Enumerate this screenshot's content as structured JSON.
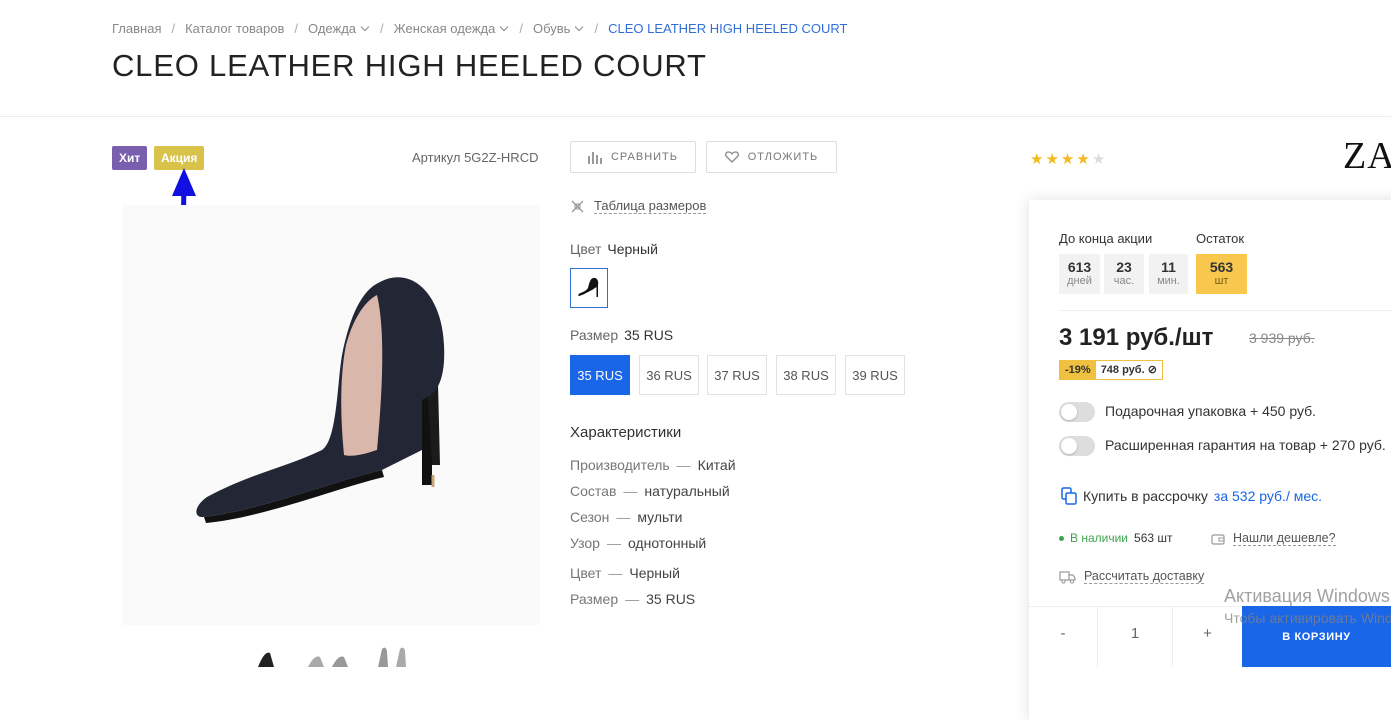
{
  "breadcrumb": {
    "items": [
      "Главная",
      "Каталог товаров",
      "Одежда",
      "Женская одежда",
      "Обувь"
    ],
    "current": "CLEO LEATHER HIGH HEELED COURT"
  },
  "product": {
    "title": "CLEO LEATHER HIGH HEELED COURT",
    "badges": {
      "hit": "Хит",
      "sale": "Акция"
    },
    "article": "Артикул 5G2Z-HRCD",
    "rating": 4
  },
  "actions": {
    "compare": "СРАВНИТЬ",
    "defer": "ОТЛОЖИТЬ",
    "size_table": "Таблица размеров"
  },
  "brand": "ZAR",
  "color": {
    "label": "Цвет",
    "value": "Черный"
  },
  "size": {
    "label": "Размер",
    "value": "35 RUS",
    "options": [
      "35 RUS",
      "36 RUS",
      "37 RUS",
      "38 RUS",
      "39 RUS"
    ]
  },
  "characteristics": {
    "title": "Характеристики",
    "rows": [
      {
        "k": "Производитель",
        "v": "Китай"
      },
      {
        "k": "Состав",
        "v": "натуральный"
      },
      {
        "k": "Сезон",
        "v": "мульти"
      },
      {
        "k": "Узор",
        "v": "однотонный"
      },
      {
        "k": "Цвет",
        "v": "Черный"
      },
      {
        "k": "Размер",
        "v": "35 RUS"
      }
    ]
  },
  "buy": {
    "timer_label": "До конца акции",
    "stock_label": "Остаток",
    "timer": [
      {
        "n": "613",
        "u": "дней"
      },
      {
        "n": "23",
        "u": "час."
      },
      {
        "n": "11",
        "u": "мин."
      }
    ],
    "stock": {
      "n": "563",
      "u": "шт"
    },
    "price": "3 191 руб./шт",
    "old_price": "3 939 руб.",
    "discount_pct": "-19%",
    "discount_amount": "748 руб.",
    "options": [
      "Подарочная упаковка + 450 руб.",
      "Расширенная гарантия на товар + 270 руб."
    ],
    "installment_text": "Купить в рассрочку",
    "installment_link": "за 532 руб./ мес.",
    "availability": "В наличии",
    "availability_count": "563 шт",
    "cheaper": "Нашли дешевле?",
    "delivery": "Рассчитать доставку",
    "qty": {
      "minus": "-",
      "value": "1",
      "plus": "+"
    },
    "cart": "В КОРЗИНУ"
  },
  "watermark": {
    "line1": "Активация Windows",
    "line2": "Чтобы активировать Windows"
  },
  "colors": {
    "accent": "#1a66e8",
    "hit": "#7a5fae",
    "sale": "#d9c24a",
    "stock": "#f8c84e",
    "annotation_arrow": "#1010e0"
  }
}
